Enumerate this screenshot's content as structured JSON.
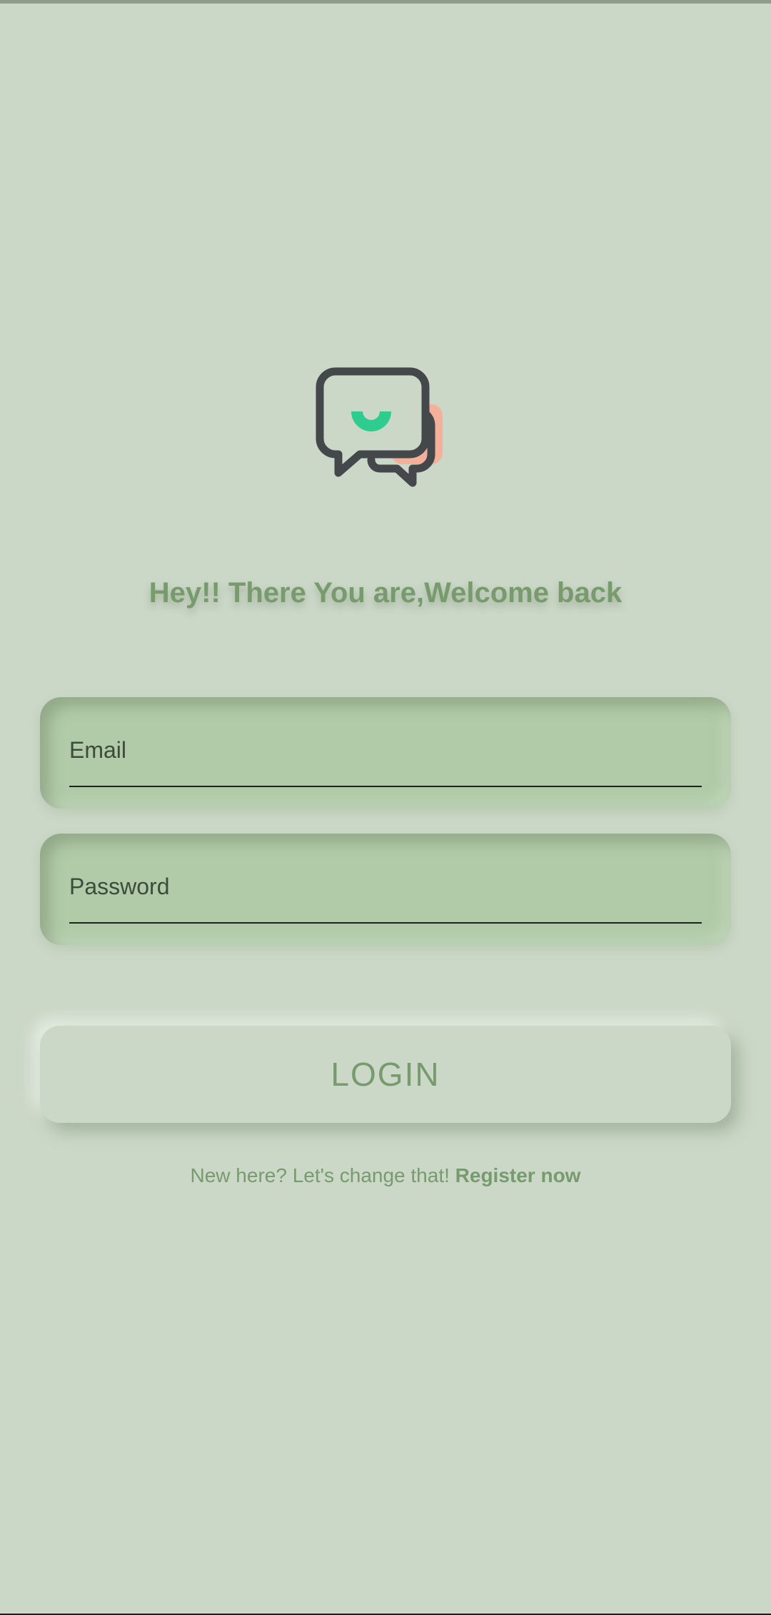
{
  "logo": {
    "icon": "chat-bubbles-icon",
    "colors": {
      "outline": "#45484b",
      "smile": "#2ecc8f",
      "accent": "#f4b09a"
    }
  },
  "welcome_text": "Hey!! There You are,Welcome back",
  "form": {
    "email_label": "Email",
    "password_label": "Password"
  },
  "login_button": "LOGIN",
  "register": {
    "prompt": "New here? Let's change that! ",
    "link": "Register now"
  },
  "colors": {
    "background": "#cbd7c7",
    "field_background": "#b1caa8",
    "accent_text": "#789b6e",
    "label_text": "#3d4b3a"
  }
}
